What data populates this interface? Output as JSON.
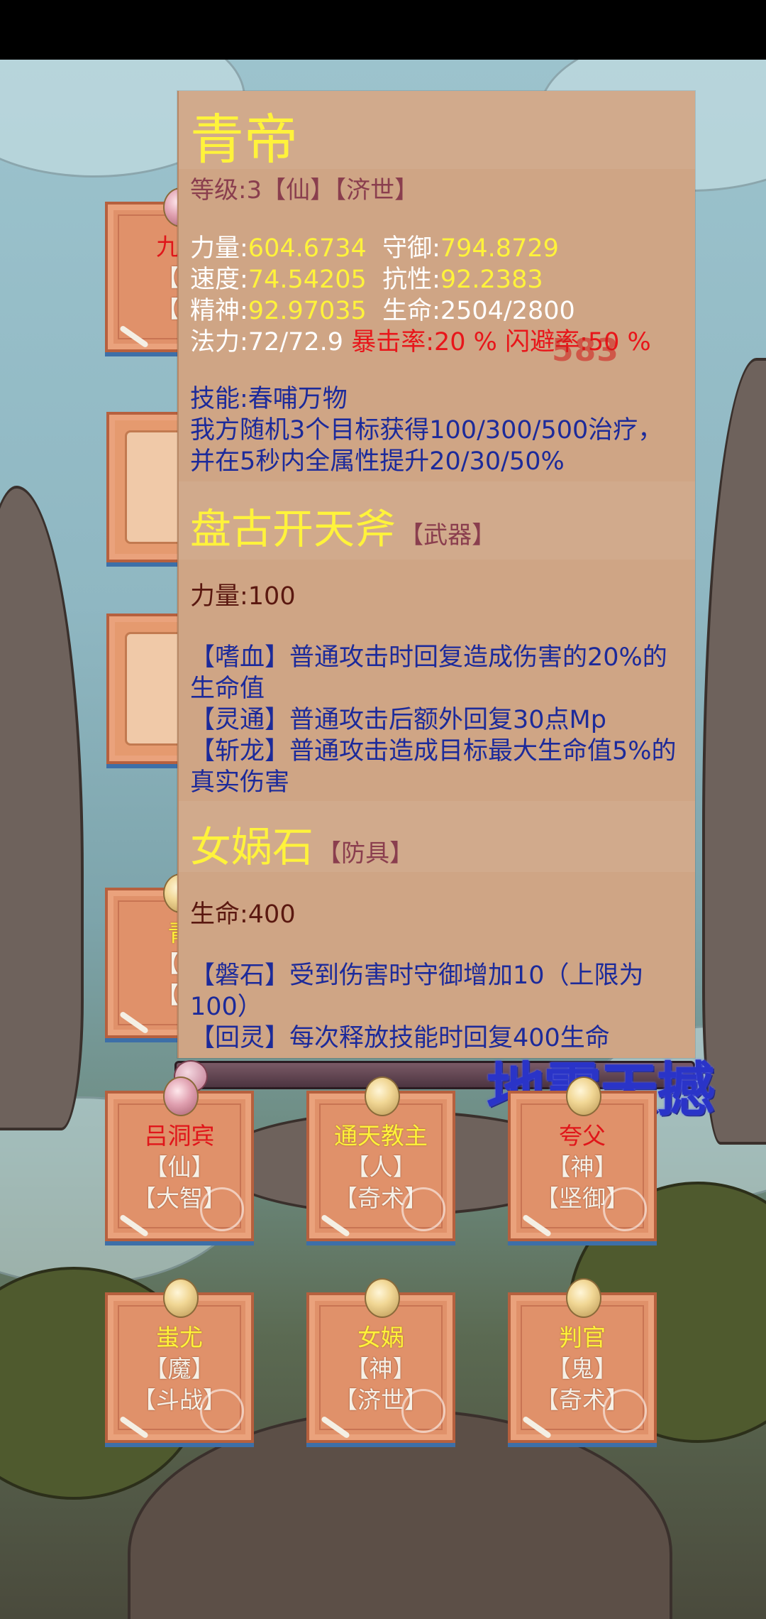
{
  "hero_panel": {
    "name": "青帝",
    "meta": "等级:3【仙】【济世】",
    "stats": {
      "str_label": "力量:",
      "str_value": "604.6734",
      "def_label": "守御:",
      "def_value": "794.8729",
      "spd_label": "速度:",
      "spd_value": "74.54205",
      "res_label": "抗性:",
      "res_value": "92.2383",
      "spi_label": "精神:",
      "spi_value": "92.97035",
      "hp_text": "生命:2504/2800",
      "mana_text": "法力:72/72.9",
      "crit_text": "暴击率:20 %",
      "dodge_text": "闪避率:50 %"
    },
    "damage_popup": "583",
    "skill_name": "技能:春哺万物",
    "skill_desc_1": "我方随机3个目标获得100/300/500治疗，",
    "skill_desc_2": "并在5秒内全属性提升20/30/50%",
    "weapon": {
      "name": "盘古开天斧",
      "tag": "【武器】",
      "stat": "力量:100",
      "effects": [
        "【嗜血】普通攻击时回复造成伤害的20%的生命值",
        "【灵通】普通攻击后额外回复30点Mp",
        "【斩龙】普通攻击造成目标最大生命值5%的真实伤害"
      ]
    },
    "armor": {
      "name": "女娲石",
      "tag": "【防具】",
      "stat": "生命:400",
      "effects": [
        "【磐石】受到伤害时守御增加10（上限为100）",
        "【回灵】每次释放技能时回复400生命"
      ]
    }
  },
  "skill_banner": "地震天撼",
  "partial_cards": [
    {
      "name": "九尾",
      "line2": "【兽",
      "line3": "【济"
    },
    {
      "name": "青",
      "line2": "【仙",
      "line3": "【济"
    }
  ],
  "cards_row1": [
    {
      "name": "吕洞宾",
      "race": "【仙】",
      "trait": "【大智】",
      "name_color": "red"
    },
    {
      "name": "通天教主",
      "race": "【人】",
      "trait": "【奇术】",
      "name_color": "yellow"
    },
    {
      "name": "夸父",
      "race": "【神】",
      "trait": "【坚御】",
      "name_color": "red"
    }
  ],
  "cards_row2": [
    {
      "name": "蚩尤",
      "race": "【魔】",
      "trait": "【斗战】",
      "name_color": "yellow"
    },
    {
      "name": "女娲",
      "race": "【神】",
      "trait": "【济世】",
      "name_color": "yellow"
    },
    {
      "name": "判官",
      "race": "【鬼】",
      "trait": "【奇术】",
      "name_color": "yellow"
    }
  ]
}
